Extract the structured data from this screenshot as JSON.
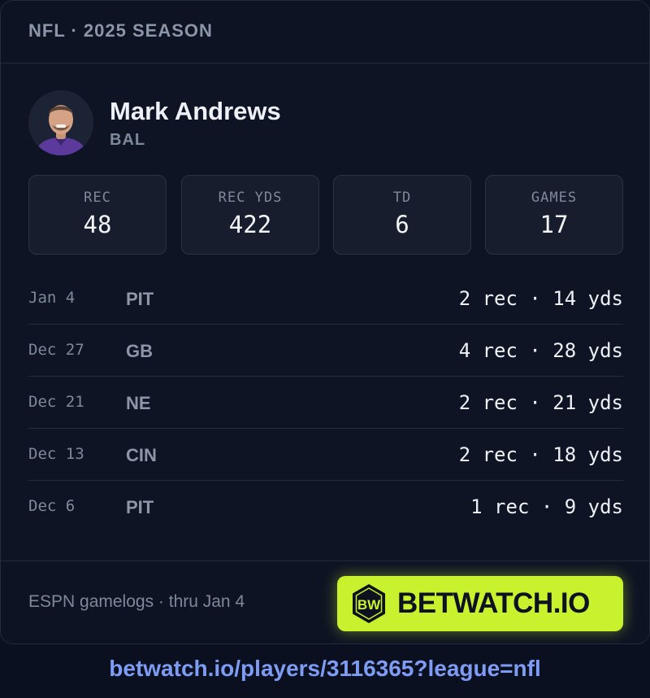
{
  "header": {
    "league_season": "NFL · 2025 SEASON"
  },
  "player": {
    "name": "Mark Andrews",
    "team": "BAL"
  },
  "stats": [
    {
      "label": "REC",
      "value": "48"
    },
    {
      "label": "REC YDS",
      "value": "422"
    },
    {
      "label": "TD",
      "value": "6"
    },
    {
      "label": "GAMES",
      "value": "17"
    }
  ],
  "games": [
    {
      "date": "Jan 4",
      "opponent": "PIT",
      "line": "2 rec · 14 yds"
    },
    {
      "date": "Dec 27",
      "opponent": "GB",
      "line": "4 rec · 28 yds"
    },
    {
      "date": "Dec 21",
      "opponent": "NE",
      "line": "2 rec · 21 yds"
    },
    {
      "date": "Dec 13",
      "opponent": "CIN",
      "line": "2 rec · 18 yds"
    },
    {
      "date": "Dec 6",
      "opponent": "PIT",
      "line": "1 rec · 9 yds"
    }
  ],
  "footer": {
    "source": "ESPN gamelogs · thru Jan 4",
    "brand": "BETWATCH.IO",
    "logo_letters": "BW"
  },
  "link": {
    "url_text": "betwatch.io/players/3116365?league=nfl"
  },
  "colors": {
    "accent": "#c8f22e",
    "background": "#0f1424",
    "link": "#7f9cf5"
  }
}
